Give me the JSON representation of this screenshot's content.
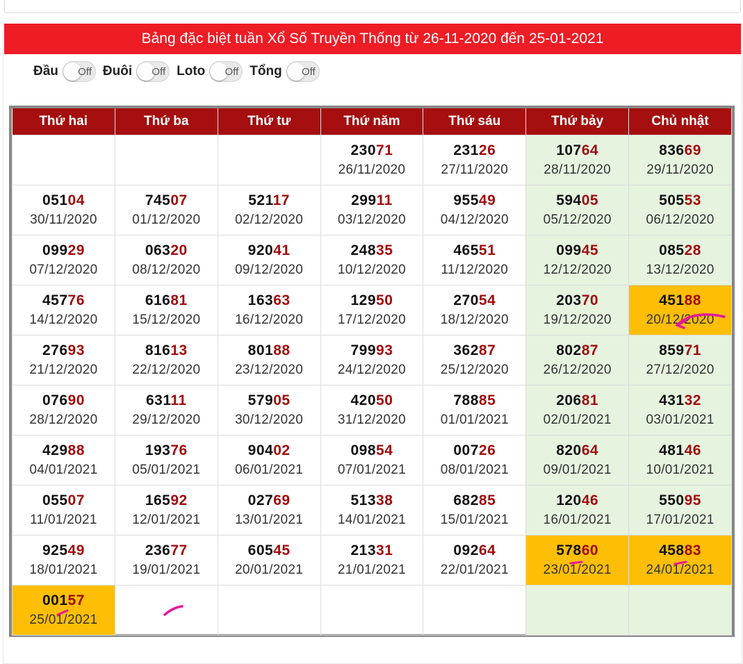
{
  "title": "Bảng đặc biệt tuần Xổ Số Truyền Thống từ 26-11-2020 đến 25-01-2021",
  "filters": [
    {
      "label": "Đầu",
      "state": "Off"
    },
    {
      "label": "Đuôi",
      "state": "Off"
    },
    {
      "label": "Loto",
      "state": "Off"
    },
    {
      "label": "Tổng",
      "state": "Off"
    }
  ],
  "weekdays": [
    "Thứ hai",
    "Thứ ba",
    "Thứ tư",
    "Thứ năm",
    "Thứ sáu",
    "Thứ bảy",
    "Chủ nhật"
  ],
  "colors": {
    "title_bar": "#ee1c25",
    "header_row": "#a50f0f",
    "weekend_cell": "#e5f3df",
    "highlight_cell": "#fdbe05",
    "number_tail": "#a00d0d",
    "annotation": "#e5199a"
  },
  "rows": [
    [
      null,
      null,
      null,
      {
        "head": "230",
        "tail": "71",
        "date": "26/11/2020"
      },
      {
        "head": "231",
        "tail": "26",
        "date": "27/11/2020"
      },
      {
        "head": "107",
        "tail": "64",
        "date": "28/11/2020"
      },
      {
        "head": "836",
        "tail": "69",
        "date": "29/11/2020"
      }
    ],
    [
      {
        "head": "051",
        "tail": "04",
        "date": "30/11/2020"
      },
      {
        "head": "745",
        "tail": "07",
        "date": "01/12/2020"
      },
      {
        "head": "521",
        "tail": "17",
        "date": "02/12/2020"
      },
      {
        "head": "299",
        "tail": "11",
        "date": "03/12/2020"
      },
      {
        "head": "955",
        "tail": "49",
        "date": "04/12/2020"
      },
      {
        "head": "594",
        "tail": "05",
        "date": "05/12/2020"
      },
      {
        "head": "505",
        "tail": "53",
        "date": "06/12/2020"
      }
    ],
    [
      {
        "head": "099",
        "tail": "29",
        "date": "07/12/2020"
      },
      {
        "head": "063",
        "tail": "20",
        "date": "08/12/2020"
      },
      {
        "head": "920",
        "tail": "41",
        "date": "09/12/2020"
      },
      {
        "head": "248",
        "tail": "35",
        "date": "10/12/2020"
      },
      {
        "head": "465",
        "tail": "51",
        "date": "11/12/2020"
      },
      {
        "head": "099",
        "tail": "45",
        "date": "12/12/2020"
      },
      {
        "head": "085",
        "tail": "28",
        "date": "13/12/2020"
      }
    ],
    [
      {
        "head": "457",
        "tail": "76",
        "date": "14/12/2020"
      },
      {
        "head": "616",
        "tail": "81",
        "date": "15/12/2020"
      },
      {
        "head": "163",
        "tail": "63",
        "date": "16/12/2020"
      },
      {
        "head": "129",
        "tail": "50",
        "date": "17/12/2020"
      },
      {
        "head": "270",
        "tail": "54",
        "date": "18/12/2020"
      },
      {
        "head": "203",
        "tail": "70",
        "date": "19/12/2020"
      },
      {
        "head": "451",
        "tail": "88",
        "date": "20/12/2020",
        "highlight": true
      }
    ],
    [
      {
        "head": "276",
        "tail": "93",
        "date": "21/12/2020"
      },
      {
        "head": "816",
        "tail": "13",
        "date": "22/12/2020"
      },
      {
        "head": "801",
        "tail": "88",
        "date": "23/12/2020"
      },
      {
        "head": "799",
        "tail": "93",
        "date": "24/12/2020"
      },
      {
        "head": "362",
        "tail": "87",
        "date": "25/12/2020"
      },
      {
        "head": "802",
        "tail": "87",
        "date": "26/12/2020"
      },
      {
        "head": "859",
        "tail": "71",
        "date": "27/12/2020"
      }
    ],
    [
      {
        "head": "076",
        "tail": "90",
        "date": "28/12/2020"
      },
      {
        "head": "631",
        "tail": "11",
        "date": "29/12/2020"
      },
      {
        "head": "579",
        "tail": "05",
        "date": "30/12/2020"
      },
      {
        "head": "420",
        "tail": "50",
        "date": "31/12/2020"
      },
      {
        "head": "788",
        "tail": "85",
        "date": "01/01/2021"
      },
      {
        "head": "206",
        "tail": "81",
        "date": "02/01/2021"
      },
      {
        "head": "431",
        "tail": "32",
        "date": "03/01/2021"
      }
    ],
    [
      {
        "head": "429",
        "tail": "88",
        "date": "04/01/2021"
      },
      {
        "head": "193",
        "tail": "76",
        "date": "05/01/2021"
      },
      {
        "head": "904",
        "tail": "02",
        "date": "06/01/2021"
      },
      {
        "head": "098",
        "tail": "54",
        "date": "07/01/2021"
      },
      {
        "head": "007",
        "tail": "26",
        "date": "08/01/2021"
      },
      {
        "head": "820",
        "tail": "64",
        "date": "09/01/2021"
      },
      {
        "head": "481",
        "tail": "46",
        "date": "10/01/2021"
      }
    ],
    [
      {
        "head": "055",
        "tail": "07",
        "date": "11/01/2021"
      },
      {
        "head": "165",
        "tail": "92",
        "date": "12/01/2021"
      },
      {
        "head": "027",
        "tail": "69",
        "date": "13/01/2021"
      },
      {
        "head": "513",
        "tail": "38",
        "date": "14/01/2021"
      },
      {
        "head": "682",
        "tail": "85",
        "date": "15/01/2021"
      },
      {
        "head": "120",
        "tail": "46",
        "date": "16/01/2021"
      },
      {
        "head": "550",
        "tail": "95",
        "date": "17/01/2021"
      }
    ],
    [
      {
        "head": "925",
        "tail": "49",
        "date": "18/01/2021"
      },
      {
        "head": "236",
        "tail": "77",
        "date": "19/01/2021"
      },
      {
        "head": "605",
        "tail": "45",
        "date": "20/01/2021"
      },
      {
        "head": "213",
        "tail": "31",
        "date": "21/01/2021"
      },
      {
        "head": "092",
        "tail": "64",
        "date": "22/01/2021"
      },
      {
        "head": "578",
        "tail": "60",
        "date": "23/01/2021",
        "highlight": true
      },
      {
        "head": "458",
        "tail": "83",
        "date": "24/01/2021",
        "highlight": true
      }
    ],
    [
      {
        "head": "001",
        "tail": "57",
        "date": "25/01/2021",
        "highlight": true
      },
      null,
      null,
      null,
      null,
      null,
      null
    ]
  ]
}
